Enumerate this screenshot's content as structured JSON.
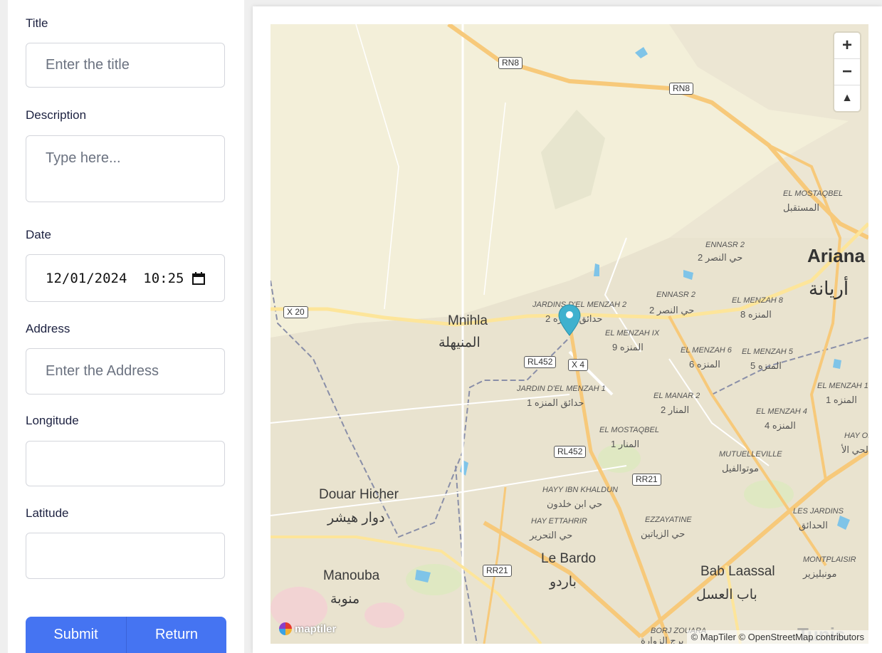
{
  "form": {
    "title_label": "Title",
    "title_placeholder": "Enter the title",
    "description_label": "Description",
    "description_placeholder": "Type here...",
    "date_label": "Date",
    "date_value": "12/01/2024  10:25",
    "address_label": "Address",
    "address_placeholder": "Enter the Address",
    "longitude_label": "Longitude",
    "longitude_value": "",
    "latitude_label": "Latitude",
    "latitude_value": "",
    "submit_label": "Submit",
    "return_label": "Return"
  },
  "map": {
    "zoom_in": "+",
    "zoom_out": "−",
    "compass": "▲",
    "attribution": "© MapTiler © OpenStreetMap contributors",
    "logo": "maptiler",
    "places": {
      "mnihla": "Mnihla",
      "mnihla_ar": "المنيهلة",
      "ariana": "Ariana",
      "ariana_ar": "أريانة",
      "douar_hicher": "Douar Hicher",
      "douar_hicher_ar": "دوار هيشر",
      "manouba": "Manouba",
      "manouba_ar": "منوبة",
      "le_bardo": "Le Bardo",
      "le_bardo_ar": "باردو",
      "bab_laassal": "Bab Laassal",
      "bab_laassal_ar": "باب العسل",
      "tunis": "Tunis",
      "el_mostaqbel_top": "EL MOSTAQBEL",
      "el_mostaqbel_top_ar": "المستقبل",
      "ennasr2_a": "ENNASR 2",
      "ennasr2_a_ar": "حي النصر 2",
      "ennasr2_b": "ENNASR 2",
      "ennasr2_b_ar": "حي النصر 2",
      "jardins_menzah2": "JARDINS D'EL MENZAH 2",
      "jardins_menzah2_ar": "حدائق المنزه 2",
      "el_menzah9": "EL MENZAH IX",
      "el_menzah9_ar": "المنزه 9",
      "el_menzah8": "EL MENZAH 8",
      "el_menzah8_ar": "المنزه 8",
      "el_menzah6": "EL MENZAH 6",
      "el_menzah6_ar": "المنزه 6",
      "el_menzah5": "EL MENZAH 5",
      "el_menzah5_ar": "المنزه 5",
      "jardin_menzah1": "JARDIN D'EL MENZAH 1",
      "jardin_menzah1_ar": "حدائق المنزه 1",
      "el_manar2": "EL MANAR 2",
      "el_manar2_ar": "المنار 2",
      "el_menzah1": "EL MENZAH 1",
      "el_menzah1_ar": "المنزه 1",
      "el_menzah4": "EL MENZAH 4",
      "el_menzah4_ar": "المنزه 4",
      "el_mostaqbel": "EL MOSTAQBEL",
      "el_mostaqbel_ar": "المنار 1",
      "mutuelleville": "MUTUELLEVILLE",
      "mutuelleville_ar": "موتوالفيل",
      "hay_ol": "HAY OL",
      "hay_ol_ar": "الحي الأ",
      "hayy_ibn_khaldun": "HAYY IBN KHALDUN",
      "hayy_ibn_khaldun_ar": "حي ابن خلدون",
      "hay_ettahrir": "HAY ETTAHRIR",
      "hay_ettahrir_ar": "حي التحرير",
      "ezzayatine": "EZZAYATINE",
      "ezzayatine_ar": "حي الزياتين",
      "les_jardins": "LES JARDINS",
      "les_jardins_ar": "الحدائق",
      "montplaisir": "MONTPLAISIR",
      "montplaisir_ar": "مونبليزير",
      "borj_zouara": "BORJ ZOUARA",
      "borj_zouara_ar": "برج الزوارة"
    },
    "shields": {
      "rn8_a": "RN8",
      "rn8_b": "RN8",
      "x20": "X 20",
      "rl452_a": "RL452",
      "x4": "X 4",
      "rl452_b": "RL452",
      "rr21_a": "RR21",
      "rr21_b": "RR21"
    }
  }
}
